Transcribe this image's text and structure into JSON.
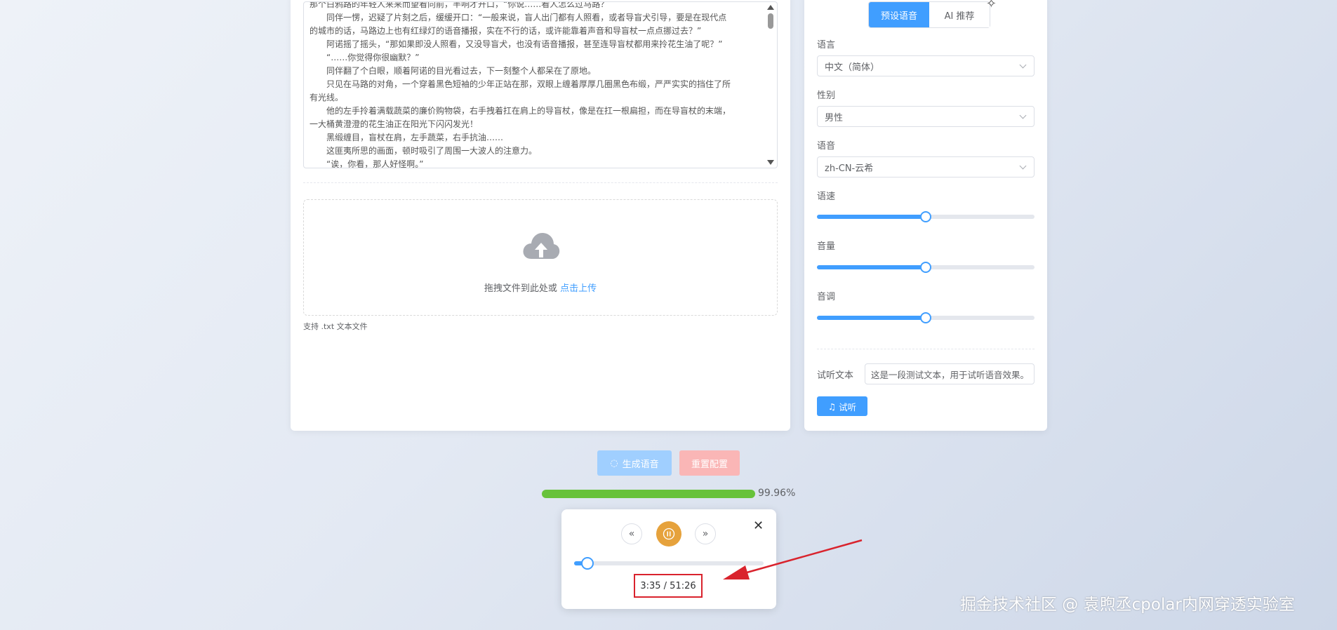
{
  "text_area": {
    "lines": [
      "那个白鸦路的年轻人来来而望看向前，半响才开口，“你说……看人怎么过马路？",
      "　　同伴一愣，迟疑了片刻之后，缓缓开口：“一般来说，盲人出门都有人照看，或者导盲犬引导，要是在现代点",
      "的城市的话，马路边上也有红绿灯的语音播报，实在不行的话，或许能靠着声音和导盲杖一点点挪过去？”",
      "　　阿诺摇了摇头，“那如果即没人照看，又没导盲犬，也没有语音播报，甚至连导盲杖都用来拎花生油了呢？”",
      "　　“……你觉得你很幽默？”",
      "　　同伴翻了个白眼，顺着阿诺的目光看过去，下一刻整个人都呆在了原地。",
      "　　只见在马路的对角，一个穿着黑色短袖的少年正站在那，双眼上缠着厚厚几圈黑色布缎，严严实实的挡住了所",
      "有光线。",
      "　　他的左手拎着满载蔬菜的廉价购物袋，右手拽着扛在肩上的导盲杖，像是在扛一根扁担，而在导盲杖的末端，",
      "一大桶黄澄澄的花生油正在阳光下闪闪发光！",
      "　　黑缎缠目，盲杖在肩，左手蔬菜，右手抗油……",
      "　　这匪夷所思的画面，顿时吸引了周围一大波人的注意力。",
      "　　“诶，你看，那人好怪啊。”"
    ]
  },
  "upload": {
    "text": "拖拽文件到此处或",
    "link": "点击上传",
    "tip": "支持 .txt 文本文件"
  },
  "voice_panel": {
    "tabs": [
      "预设语音",
      "AI 推荐"
    ],
    "language_label": "语言",
    "language_value": "中文（简体）",
    "gender_label": "性别",
    "gender_value": "男性",
    "voice_label": "语音",
    "voice_value": "zh-CN-云希",
    "speed_label": "语速",
    "speed_level": 0.5,
    "volume_label": "音量",
    "volume_level": 0.5,
    "pitch_label": "音调",
    "pitch_level": 0.5,
    "preview_label": "试听文本",
    "preview_value": "这是一段测试文本，用于试听语音效果。",
    "listen_button": "试听"
  },
  "actions": {
    "generate": "生成语音",
    "reset": "重置配置"
  },
  "progress": {
    "fraction": 0.9996,
    "text": "99.96%"
  },
  "player": {
    "position_fraction": 0.07,
    "time": "3:35 / 51:26"
  },
  "watermark": "掘金技术社区 @ 袁煦丞cpolar内网穿透实验室",
  "colors": {
    "primary": "#409eff",
    "success": "#67c23a",
    "warning": "#e6a23c",
    "annotation_red": "#d9232d"
  }
}
